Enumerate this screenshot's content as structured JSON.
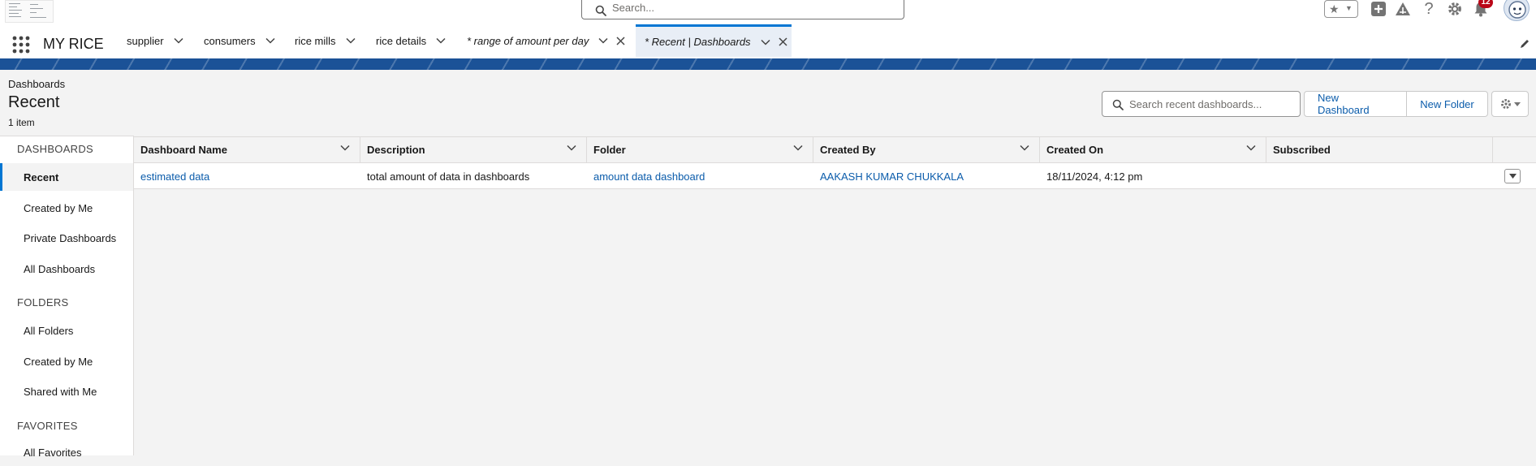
{
  "global_header": {
    "search_placeholder": "Search...",
    "notification_count": "12"
  },
  "nav": {
    "app_name": "MY RICE",
    "tabs": [
      {
        "label": "supplier"
      },
      {
        "label": "consumers"
      },
      {
        "label": "rice mills"
      },
      {
        "label": "rice details"
      },
      {
        "label": "* range of amount per day"
      },
      {
        "label": "* Recent | Dashboards"
      }
    ]
  },
  "page_header": {
    "object_label": "Dashboards",
    "title": "Recent",
    "item_count": "1 item",
    "search_placeholder": "Search recent dashboards...",
    "new_dashboard_label": "New Dashboard",
    "new_folder_label": "New Folder"
  },
  "sidebar": {
    "dashboards_heading": "DASHBOARDS",
    "dashboards_items": [
      {
        "label": "Recent"
      },
      {
        "label": "Created by Me"
      },
      {
        "label": "Private Dashboards"
      },
      {
        "label": "All Dashboards"
      }
    ],
    "folders_heading": "FOLDERS",
    "folders_items": [
      {
        "label": "All Folders"
      },
      {
        "label": "Created by Me"
      },
      {
        "label": "Shared with Me"
      }
    ],
    "favorites_heading": "FAVORITES",
    "favorites_items": [
      {
        "label": "All Favorites"
      }
    ]
  },
  "table": {
    "columns": [
      "Dashboard Name",
      "Description",
      "Folder",
      "Created By",
      "Created On",
      "Subscribed"
    ],
    "rows": [
      {
        "dashboard_name": "estimated data",
        "description": "total amount of data in dashboards",
        "folder": "amount data dashboard",
        "created_by": "AAKASH KUMAR CHUKKALA",
        "created_on": "18/11/2024, 4:12 pm",
        "subscribed": ""
      }
    ]
  },
  "colors": {
    "brand_blue": "#0176d3",
    "link_blue": "#0b5cab",
    "band_blue": "#1b5297",
    "badge_red": "#ba0517"
  }
}
